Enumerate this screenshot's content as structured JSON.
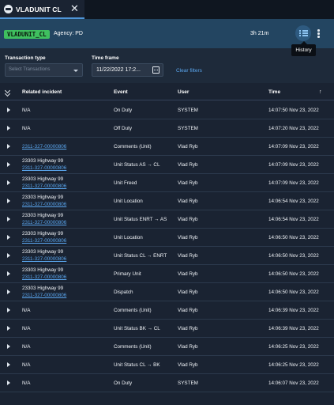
{
  "tab": {
    "title": "VLADUNIT CL",
    "close": "✕"
  },
  "header": {
    "unit_badge": "VLADUNIT_CL",
    "agency": "Agency: PD",
    "duration": "3h 21m",
    "tooltip": "History"
  },
  "filters": {
    "transaction_type_label": "Transaction type",
    "transaction_type_placeholder": "Select Transactions",
    "time_frame_label": "Time frame",
    "time_frame_value": "11/22/2022 17:2...",
    "clear_label": "Clear filters"
  },
  "table": {
    "columns": [
      "Related incident",
      "Event",
      "User",
      "Time"
    ],
    "sort_indicator": "↑",
    "rows": [
      {
        "address": "",
        "incident": "N/A",
        "incident_link": false,
        "event": "On Duty",
        "user": "SYSTEM",
        "time": "14:07:50 Nov 23, 2022"
      },
      {
        "address": "",
        "incident": "N/A",
        "incident_link": false,
        "event": "Off Duty",
        "user": "SYSTEM",
        "time": "14:07:20 Nov 23, 2022"
      },
      {
        "address": "",
        "incident": "2311-327-00000806",
        "incident_link": true,
        "event": "Comments (Unit)",
        "user": "Vlad Ryb",
        "time": "14:07:09 Nov 23, 2022"
      },
      {
        "address": "23303 Highway 99",
        "incident": "2311-327-00000806",
        "incident_link": true,
        "event": "Unit Status AS → CL",
        "user": "Vlad Ryb",
        "time": "14:07:09 Nov 23, 2022"
      },
      {
        "address": "23303 Highway 99",
        "incident": "2311-327-00000806",
        "incident_link": true,
        "event": "Unit Freed",
        "user": "Vlad Ryb",
        "time": "14:07:09 Nov 23, 2022"
      },
      {
        "address": "23303 Highway 99",
        "incident": "2311-327-00000806",
        "incident_link": true,
        "event": "Unit Location",
        "user": "Vlad Ryb",
        "time": "14:06:54 Nov 23, 2022"
      },
      {
        "address": "23303 Highway 99",
        "incident": "2311-327-00000806",
        "incident_link": true,
        "event": "Unit Status ENRT → AS",
        "user": "Vlad Ryb",
        "time": "14:06:54 Nov 23, 2022"
      },
      {
        "address": "23303 Highway 99",
        "incident": "2311-327-00000806",
        "incident_link": true,
        "event": "Unit Location",
        "user": "Vlad Ryb",
        "time": "14:06:50 Nov 23, 2022"
      },
      {
        "address": "23303 Highway 99",
        "incident": "2311-327-00000806",
        "incident_link": true,
        "event": "Unit Status CL → ENRT",
        "user": "Vlad Ryb",
        "time": "14:06:50 Nov 23, 2022"
      },
      {
        "address": "23303 Highway 99",
        "incident": "2311-327-00000806",
        "incident_link": true,
        "event": "Primary Unit",
        "user": "Vlad Ryb",
        "time": "14:06:50 Nov 23, 2022"
      },
      {
        "address": "23303 Highway 99",
        "incident": "2311-327-00000806",
        "incident_link": true,
        "event": "Dispatch",
        "user": "Vlad Ryb",
        "time": "14:06:50 Nov 23, 2022"
      },
      {
        "address": "",
        "incident": "N/A",
        "incident_link": false,
        "event": "Comments (Unit)",
        "user": "Vlad Ryb",
        "time": "14:06:39 Nov 23, 2022"
      },
      {
        "address": "",
        "incident": "N/A",
        "incident_link": false,
        "event": "Unit Status BK → CL",
        "user": "Vlad Ryb",
        "time": "14:06:39 Nov 23, 2022"
      },
      {
        "address": "",
        "incident": "N/A",
        "incident_link": false,
        "event": "Comments (Unit)",
        "user": "Vlad Ryb",
        "time": "14:06:25 Nov 23, 2022"
      },
      {
        "address": "",
        "incident": "N/A",
        "incident_link": false,
        "event": "Unit Status CL → BK",
        "user": "Vlad Ryb",
        "time": "14:06:25 Nov 23, 2022"
      },
      {
        "address": "",
        "incident": "N/A",
        "incident_link": false,
        "event": "On Duty",
        "user": "SYSTEM",
        "time": "14:06:07 Nov 23, 2022"
      }
    ]
  },
  "colors": {
    "accent": "#4f95d8",
    "badge": "#3fbf5f",
    "link": "#5aa6ee",
    "header_bg": "#234561",
    "page_bg": "#1a2332"
  }
}
